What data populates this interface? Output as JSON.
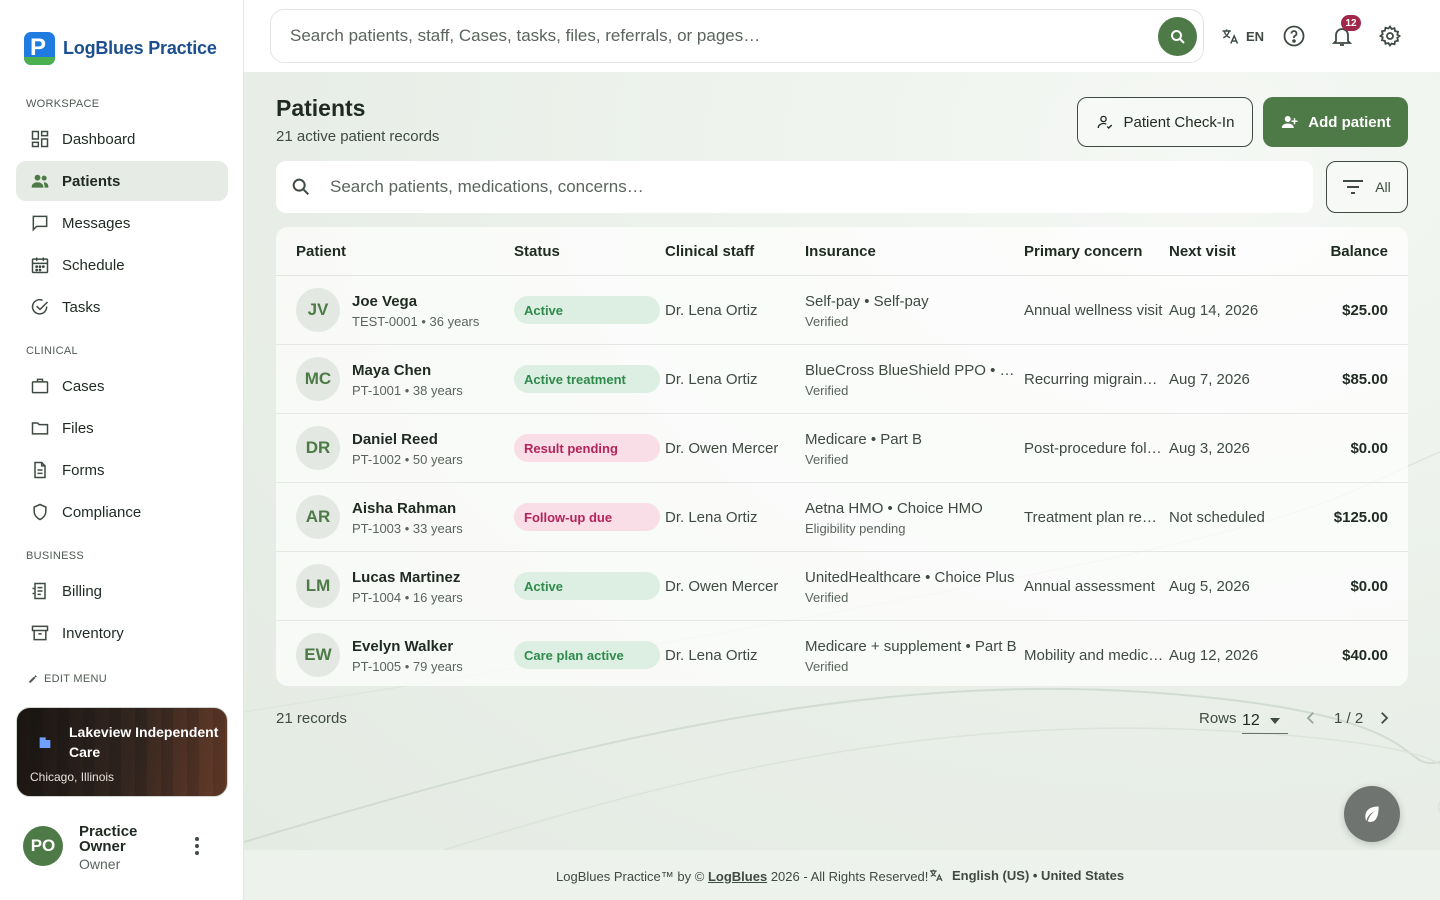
{
  "brand": {
    "name": "LogBlues Practice",
    "logo_letter": "P"
  },
  "nav": {
    "sections": [
      {
        "label": "WORKSPACE",
        "items": [
          {
            "label": "Dashboard",
            "icon": "dashboard-icon"
          },
          {
            "label": "Patients",
            "icon": "people-icon",
            "active": true
          },
          {
            "label": "Messages",
            "icon": "chat-icon"
          },
          {
            "label": "Schedule",
            "icon": "calendar-icon"
          },
          {
            "label": "Tasks",
            "icon": "check-circle-icon"
          }
        ]
      },
      {
        "label": "CLINICAL",
        "items": [
          {
            "label": "Cases",
            "icon": "briefcase-icon"
          },
          {
            "label": "Files",
            "icon": "folder-icon"
          },
          {
            "label": "Forms",
            "icon": "document-icon"
          },
          {
            "label": "Compliance",
            "icon": "shield-icon"
          }
        ]
      },
      {
        "label": "BUSINESS",
        "items": [
          {
            "label": "Billing",
            "icon": "receipt-icon"
          },
          {
            "label": "Inventory",
            "icon": "archive-icon"
          }
        ]
      }
    ],
    "edit_menu": "EDIT MENU"
  },
  "org": {
    "name": "Lakeview Independent Care",
    "location": "Chicago, Illinois"
  },
  "user": {
    "initials": "PO",
    "name": "Practice Owner",
    "role": "Owner"
  },
  "topbar": {
    "search_placeholder": "Search patients, staff, Cases, tasks, files, referrals, or pages…",
    "language": "EN",
    "notifications_count": "12"
  },
  "page": {
    "title": "Patients",
    "subtitle": "21 active patient records",
    "checkin_label": "Patient Check-In",
    "add_label": "Add patient",
    "table_search_placeholder": "Search patients, medications, concerns…",
    "filter_label": "All"
  },
  "table": {
    "columns": [
      "Patient",
      "Status",
      "Clinical staff",
      "Insurance",
      "Primary concern",
      "Next visit",
      "Balance"
    ],
    "rows": [
      {
        "initials": "JV",
        "name": "Joe Vega",
        "meta": "TEST-0001 • 36 years",
        "status": "Active",
        "status_tone": "green",
        "staff": "Dr. Lena Ortiz",
        "insurance": "Self-pay • Self-pay",
        "insurance_status": "Verified",
        "concern": "Annual wellness visit",
        "next_visit": "Aug 14, 2026",
        "balance": "$25.00"
      },
      {
        "initials": "MC",
        "name": "Maya Chen",
        "meta": "PT-1001 • 38 years",
        "status": "Active treatment",
        "status_tone": "green",
        "staff": "Dr. Lena Ortiz",
        "insurance": "BlueCross BlueShield PPO • Preferred PPO",
        "insurance_status": "Verified",
        "concern": "Recurring migraine follow-up",
        "next_visit": "Aug 7, 2026",
        "balance": "$85.00"
      },
      {
        "initials": "DR",
        "name": "Daniel Reed",
        "meta": "PT-1002 • 50 years",
        "status": "Result pending",
        "status_tone": "pink",
        "staff": "Dr. Owen Mercer",
        "insurance": "Medicare • Part B",
        "insurance_status": "Verified",
        "concern": "Post-procedure follow-up",
        "next_visit": "Aug 3, 2026",
        "balance": "$0.00"
      },
      {
        "initials": "AR",
        "name": "Aisha Rahman",
        "meta": "PT-1003 • 33 years",
        "status": "Follow-up due",
        "status_tone": "pink",
        "staff": "Dr. Lena Ortiz",
        "insurance": "Aetna HMO • Choice HMO",
        "insurance_status": "Eligibility pending",
        "concern": "Treatment plan review",
        "next_visit": "Not scheduled",
        "balance": "$125.00"
      },
      {
        "initials": "LM",
        "name": "Lucas Martinez",
        "meta": "PT-1004 • 16 years",
        "status": "Active",
        "status_tone": "green",
        "staff": "Dr. Owen Mercer",
        "insurance": "UnitedHealthcare • Choice Plus",
        "insurance_status": "Verified",
        "concern": "Annual assessment",
        "next_visit": "Aug 5, 2026",
        "balance": "$0.00"
      },
      {
        "initials": "EW",
        "name": "Evelyn Walker",
        "meta": "PT-1005 • 79 years",
        "status": "Care plan active",
        "status_tone": "green",
        "staff": "Dr. Lena Ortiz",
        "insurance": "Medicare + supplement • Part B",
        "insurance_status": "Verified",
        "concern": "Mobility and medication review",
        "next_visit": "Aug 12, 2026",
        "balance": "$40.00"
      }
    ]
  },
  "pagination": {
    "records": "21 records",
    "rows_label": "Rows",
    "rows_value": "12",
    "page": "1 / 2"
  },
  "footer": {
    "prefix": "LogBlues Practice™ by ©",
    "brand": "LogBlues",
    "suffix": "2026 - All Rights Reserved!",
    "locale": "English (US) • United States"
  },
  "colors": {
    "accent": "#4d7a47",
    "badge": "#a0264a",
    "status_green": "#2f8a4c",
    "status_pink": "#b3245a"
  }
}
